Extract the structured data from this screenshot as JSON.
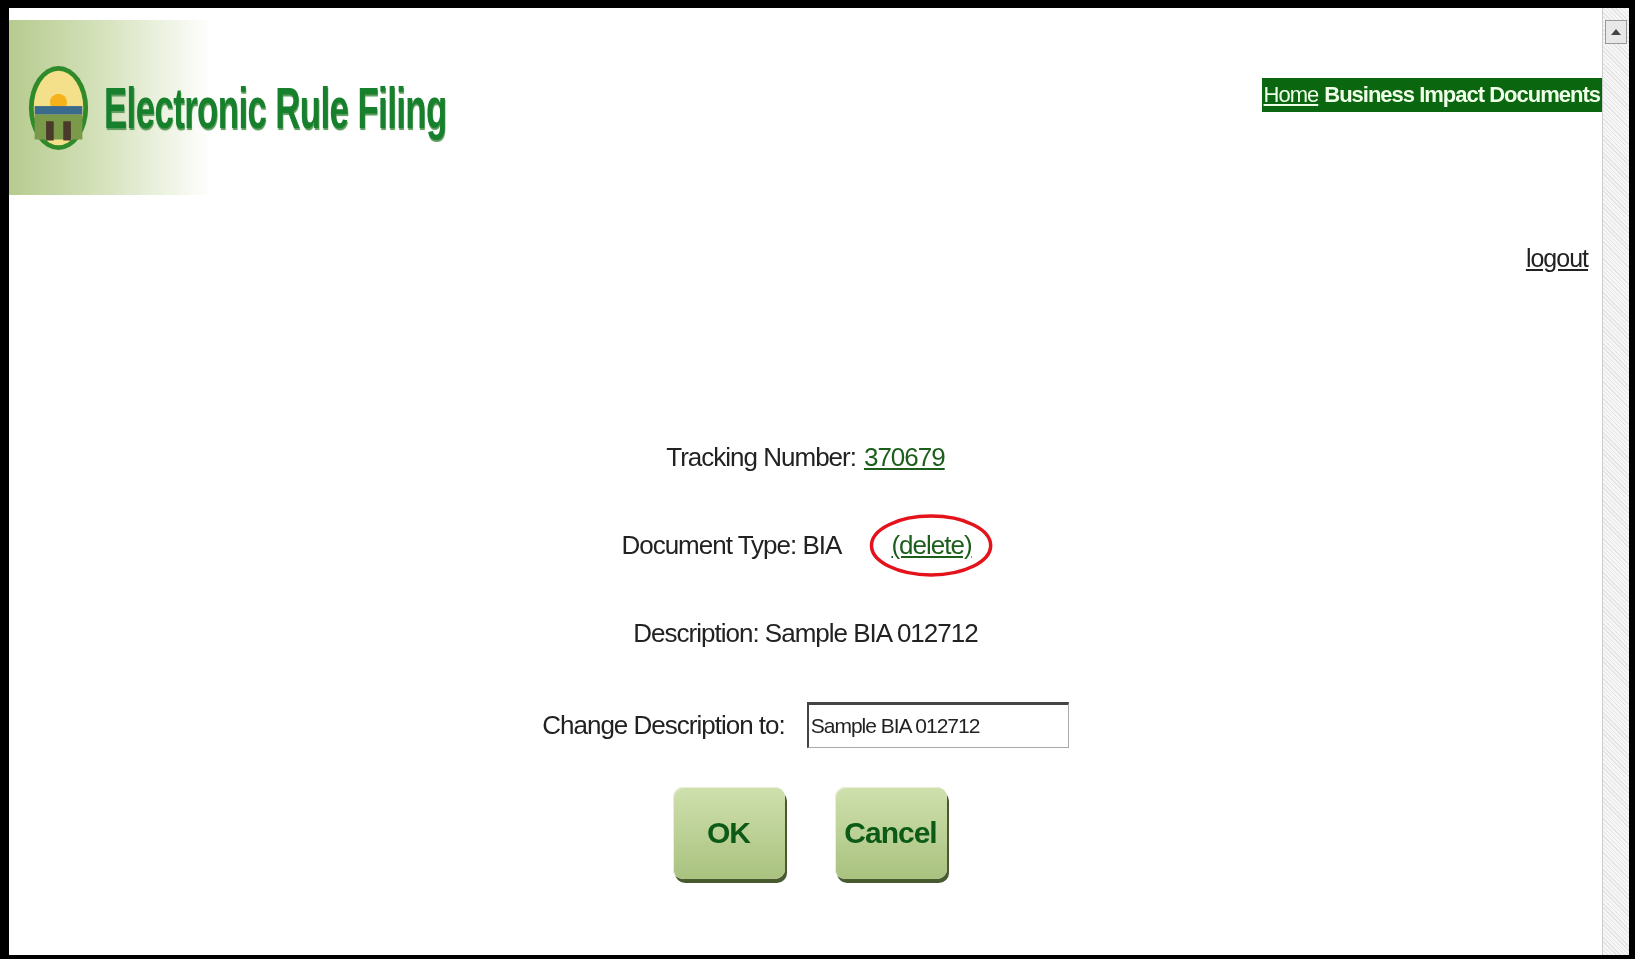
{
  "header": {
    "title": "Electronic Rule Filing",
    "nav": [
      {
        "label": "Home",
        "kind": "link"
      },
      {
        "label": "Business Impact Documents",
        "kind": "current"
      }
    ],
    "logout": "logout"
  },
  "form": {
    "tracking": {
      "label": "Tracking Number:",
      "value": "370679"
    },
    "document_type": {
      "label": "Document Type: BIA",
      "action": "(delete)",
      "highlighted": true
    },
    "description": "Description: Sample BIA 012712",
    "change": {
      "label": "Change Description to:",
      "value": "Sample BIA 012712"
    },
    "buttons": [
      "OK",
      "Cancel"
    ]
  }
}
